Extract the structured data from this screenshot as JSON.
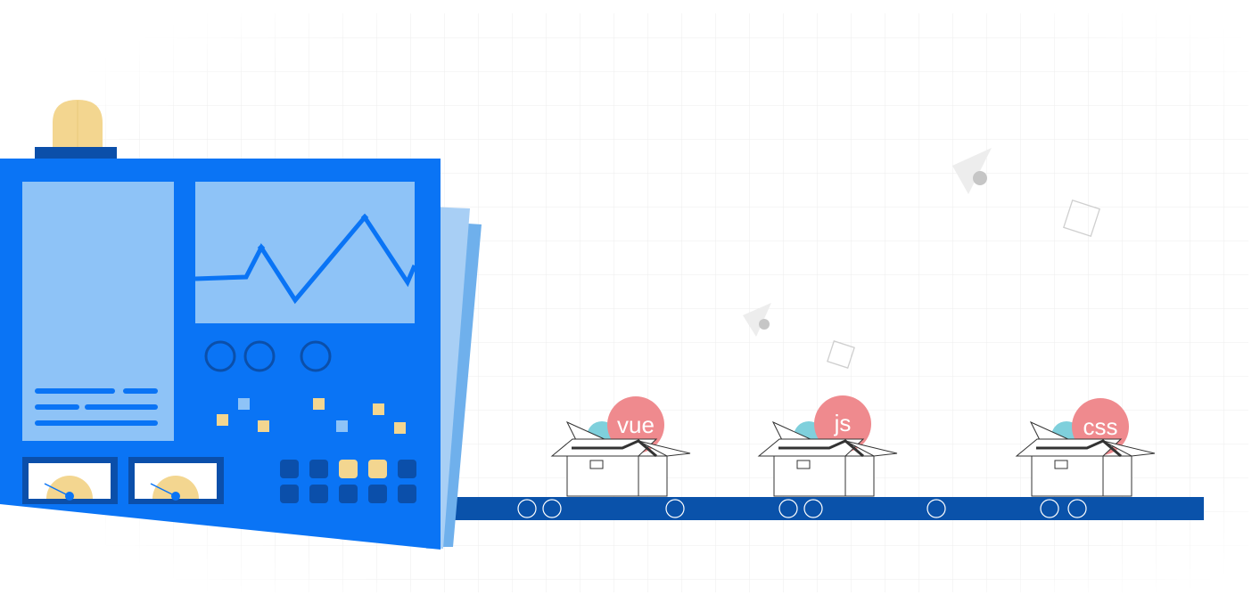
{
  "colors": {
    "machine_blue": "#0a74f5",
    "panel_light": "#8ec3f7",
    "dark_blue": "#0b4faa",
    "belt_blue": "#0a52aa",
    "lamp_yellow": "#f3d690",
    "bubble_pink": "#ef8a8e",
    "bubble_cyan": "#7fd0dc",
    "grid_gray": "#ececec"
  },
  "boxes": [
    {
      "label": "vue"
    },
    {
      "label": "js"
    },
    {
      "label": "css"
    }
  ],
  "icons": [
    "lamp-icon",
    "chart-line-icon",
    "gauge-icon",
    "paper-plane-icon",
    "square-outline-icon",
    "conveyor-roller-icon"
  ]
}
